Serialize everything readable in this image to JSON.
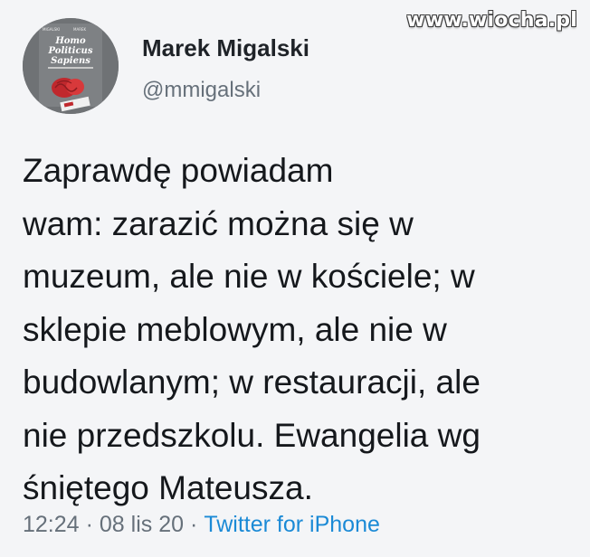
{
  "watermark": "www.wiocha.pl",
  "avatar": {
    "book_title_lines": [
      "Homo",
      "Politicus",
      "Sapiens"
    ],
    "book_authors": [
      "MIGALSKI",
      "MAREK",
      "WAGA"
    ]
  },
  "author": {
    "name": "Marek Migalski",
    "handle": "@mmigalski"
  },
  "tweet": {
    "lines": [
      "Zaprawdę powiadam",
      "wam: zarazić można się w",
      "muzeum, ale nie w kościele; w",
      "sklepie meblowym, ale nie w",
      "budowlanym; w restauracji, ale",
      "nie przedszkolu. Ewangelia wg",
      "śniętego Mateusza."
    ]
  },
  "meta": {
    "time": "12:24",
    "separator": "·",
    "date": "08 lis 20",
    "source": "Twitter for iPhone"
  },
  "colors": {
    "link": "#1b8ad6",
    "text": "#15181c",
    "muted": "#66707a",
    "background": "#f4f5f7"
  }
}
